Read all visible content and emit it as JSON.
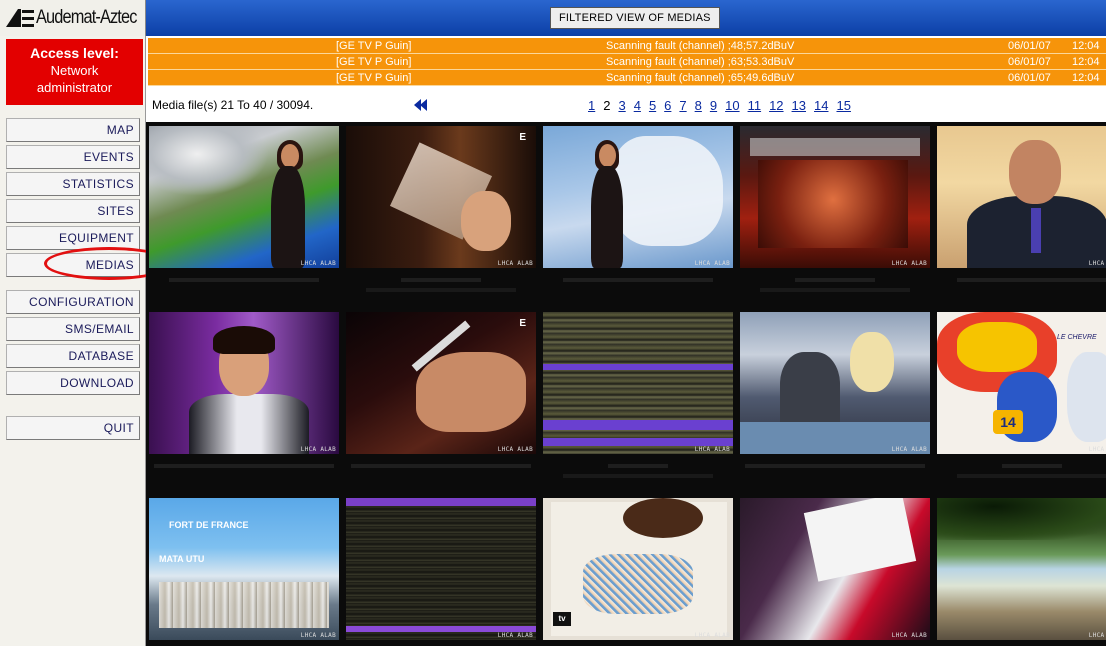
{
  "app": {
    "logo_text": "Audemat-Aztec",
    "view_title": "FILTERED VIEW OF MEDIAS"
  },
  "access": {
    "label": "Access level:",
    "line1": "Network",
    "line2": "administrator"
  },
  "nav": {
    "items": [
      {
        "label": "MAP"
      },
      {
        "label": "EVENTS"
      },
      {
        "label": "STATISTICS"
      },
      {
        "label": "SITES"
      },
      {
        "label": "EQUIPMENT"
      },
      {
        "label": "MEDIAS"
      },
      {
        "label": "CONFIGURATION"
      },
      {
        "label": "SMS/EMAIL"
      },
      {
        "label": "DATABASE"
      },
      {
        "label": "DOWNLOAD"
      },
      {
        "label": "QUIT"
      }
    ],
    "highlight": "MEDIAS",
    "highlight_color": "#e21010"
  },
  "alarms": {
    "color": "#f6940a",
    "rows": [
      {
        "source": "[GE TV P Guin]",
        "message": "Scanning fault (channel) ;48;57.2dBuV",
        "date": "06/01/07",
        "time": "12:04"
      },
      {
        "source": "[GE TV P Guin]",
        "message": "Scanning fault (channel) ;63;53.3dBuV",
        "date": "06/01/07",
        "time": "12:04"
      },
      {
        "source": "[GE TV P Guin]",
        "message": "Scanning fault (channel) ;65;49.6dBuV",
        "date": "06/01/07",
        "time": "12:04"
      }
    ]
  },
  "media": {
    "count_text": "Media file(s) 21 To 40 / 30094.",
    "prev_icon": "double-left-arrow-icon",
    "pages": [
      "1",
      "2",
      "3",
      "4",
      "5",
      "6",
      "7",
      "8",
      "9",
      "10",
      "11",
      "12",
      "13",
      "14",
      "15"
    ],
    "current_page": "2",
    "thumb_stamp": "LHCA ALAB",
    "corner_e": "E",
    "cartoon_tag": "14",
    "cartoon_label": "LE CHEVRE",
    "city_title1": "FORT DE FRANCE",
    "city_title2": "MATA UTU",
    "tv_badge": "tv",
    "thumbnails": [
      {
        "scene": "weather-europe"
      },
      {
        "scene": "glass-closeup"
      },
      {
        "scene": "weather-france"
      },
      {
        "scene": "concert"
      },
      {
        "scene": "news-anchor"
      },
      {
        "scene": "man-purple-studio"
      },
      {
        "scene": "hand-knife"
      },
      {
        "scene": "glitched-frame"
      },
      {
        "scene": "office-scene"
      },
      {
        "scene": "cartoon-hearts"
      },
      {
        "scene": "city-aerial"
      },
      {
        "scene": "dark-glitch"
      },
      {
        "scene": "sketch-drawing"
      },
      {
        "scene": "fashion-bag"
      },
      {
        "scene": "beach"
      }
    ]
  }
}
